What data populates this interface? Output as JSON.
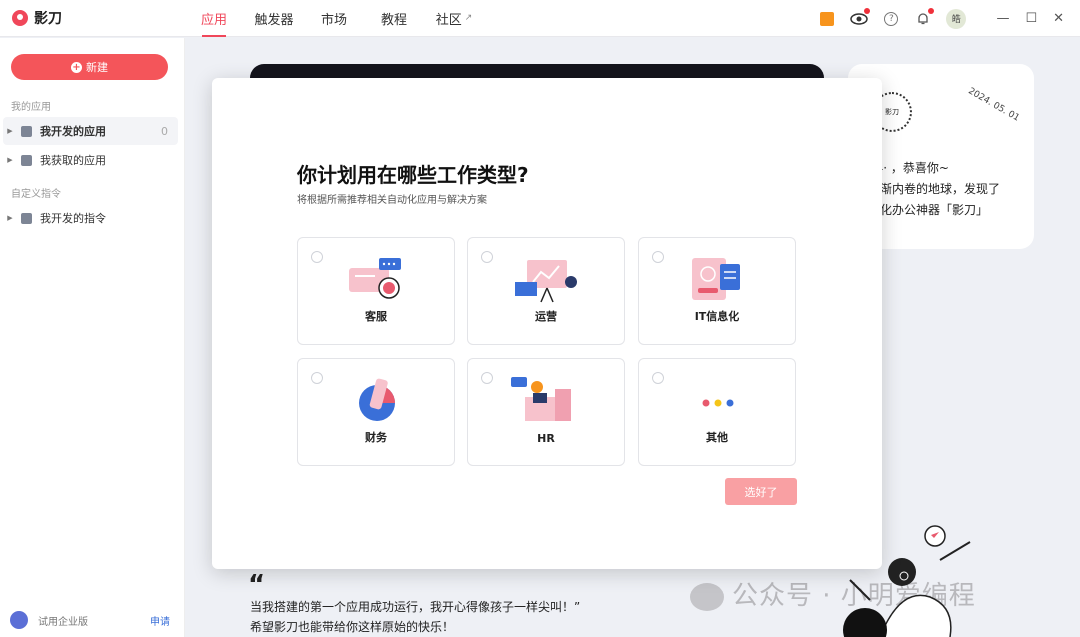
{
  "app": {
    "name": "影刀"
  },
  "nav": [
    {
      "label": "应用",
      "active": true
    },
    {
      "label": "触发器",
      "active": false
    },
    {
      "label": "市场",
      "active": false
    },
    {
      "label": "教程",
      "active": false
    },
    {
      "label": "社区",
      "active": false,
      "external": true
    }
  ],
  "user": {
    "avatar_text": "皓"
  },
  "sidebar": {
    "new_button": "新建",
    "section_apps": "我的应用",
    "items": [
      {
        "label": "我开发的应用",
        "count": "0"
      },
      {
        "label": "我获取的应用"
      }
    ],
    "section_commands": "自定义指令",
    "command_items": [
      {
        "label": "我开发的指令"
      }
    ],
    "footer": {
      "label": "试用企业版",
      "action": "申请"
    }
  },
  "background": {
    "card": {
      "date": "2024. 05. 01",
      "stamp_text": "影刀",
      "lines": [
        "24·   ，恭喜你~",
        "逐渐内卷的地球，发现了",
        "动化办公神器「影刀」"
      ]
    },
    "quote": {
      "mark": "“",
      "line1": "当我搭建的第一个应用成功运行，我开心得像孩子一样尖叫！”",
      "line2": "希望影刀也能带给你这样原始的快乐！"
    },
    "watermark": "公众号 · 小明爱编程"
  },
  "modal": {
    "title": "你计划用在哪些工作类型?",
    "subtitle": "将根据所需推荐相关自动化应用与解决方案",
    "options": [
      {
        "label": "客服",
        "icon": "customer-service-icon"
      },
      {
        "label": "运营",
        "icon": "operations-icon"
      },
      {
        "label": "IT信息化",
        "icon": "it-icon"
      },
      {
        "label": "财务",
        "icon": "finance-icon"
      },
      {
        "label": "HR",
        "icon": "hr-icon"
      },
      {
        "label": "其他",
        "icon": "other-icon"
      }
    ],
    "confirm_button": "选好了"
  },
  "colors": {
    "accent": "#f0475a",
    "button_disabled": "#f9a0a3"
  }
}
